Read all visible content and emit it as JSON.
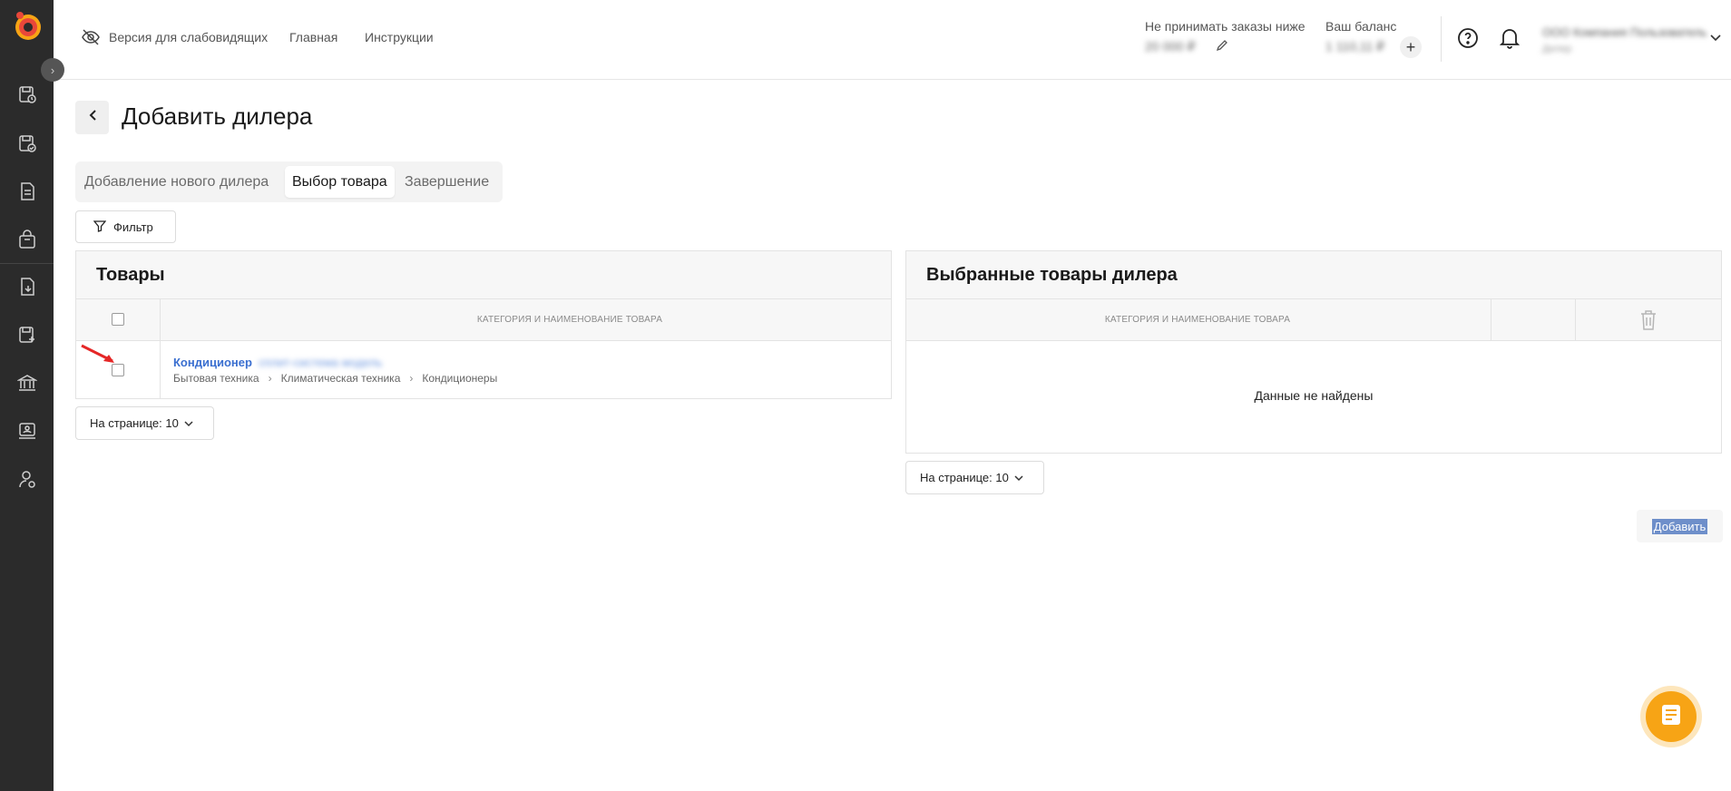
{
  "header": {
    "accessibility_label": "Версия для слабовидящих",
    "nav": [
      "Главная",
      "Инструкции"
    ],
    "min_order_label": "Не принимать заказы ниже",
    "min_order_value": "20 000 ₽",
    "balance_label": "Ваш баланс",
    "balance_value": "1 110,11 ₽",
    "user_name": "ООО Компания Пользователь",
    "user_role": "Дилер"
  },
  "page": {
    "title": "Добавить дилера"
  },
  "steps": [
    {
      "label": "Добавление нового дилера",
      "active": false
    },
    {
      "label": "Выбор товара",
      "active": true
    },
    {
      "label": "Завершение",
      "active": false
    }
  ],
  "filter_label": "Фильтр",
  "products_panel": {
    "title": "Товары",
    "column_header": "КАТЕГОРИЯ И НАИМЕНОВАНИЕ ТОВАРА",
    "rows": [
      {
        "name": "Кондиционер",
        "name_hidden": "сплит-система модель",
        "breadcrumb": [
          "Бытовая техника",
          "Климатическая техника",
          "Кондиционеры"
        ]
      }
    ],
    "per_page": "На странице: 10"
  },
  "selected_panel": {
    "title": "Выбранные товары дилера",
    "column_header": "КАТЕГОРИЯ И НАИМЕНОВАНИЕ ТОВАРА",
    "empty_message": "Данные не найдены",
    "per_page": "На странице: 10"
  },
  "add_button_label": "Добавить",
  "colors": {
    "accent": "#f7a415",
    "link": "#3a6fd0",
    "sidebar": "#2b2b2b"
  }
}
